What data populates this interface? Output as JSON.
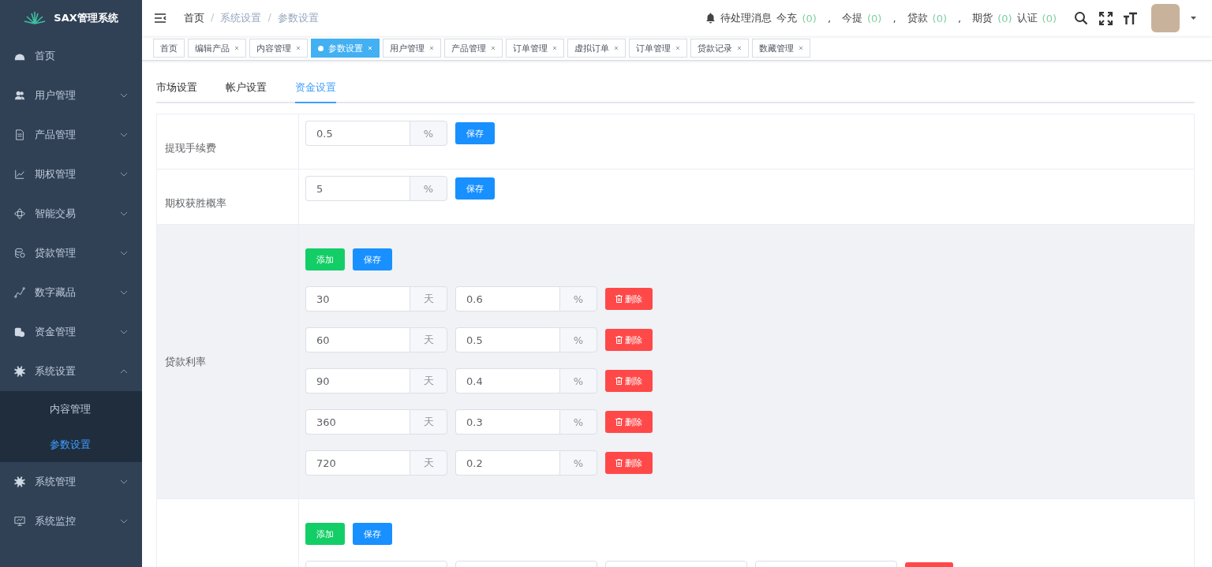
{
  "sidebar": {
    "logo": "SAX管理系统",
    "items": [
      {
        "label": "首页",
        "kind": "link"
      },
      {
        "label": "用户管理",
        "kind": "group",
        "expanded": false
      },
      {
        "label": "产品管理",
        "kind": "group",
        "expanded": false
      },
      {
        "label": "期权管理",
        "kind": "group",
        "expanded": false
      },
      {
        "label": "智能交易",
        "kind": "group",
        "expanded": false
      },
      {
        "label": "贷款管理",
        "kind": "group",
        "expanded": false
      },
      {
        "label": "数字藏品",
        "kind": "group",
        "expanded": false
      },
      {
        "label": "资金管理",
        "kind": "group",
        "expanded": false
      },
      {
        "label": "系统设置",
        "kind": "group",
        "expanded": true,
        "children": [
          {
            "label": "内容管理",
            "selected": false
          },
          {
            "label": "参数设置",
            "selected": true
          }
        ]
      },
      {
        "label": "系统管理",
        "kind": "group",
        "expanded": false
      },
      {
        "label": "系统监控",
        "kind": "group",
        "expanded": false
      }
    ]
  },
  "breadcrumb": [
    {
      "label": "首页"
    },
    {
      "separator": "/",
      "label": "系统设置"
    },
    {
      "separator": "/",
      "label": "参数设置"
    }
  ],
  "notices": {
    "title": "待处理消息",
    "items": [
      {
        "label": "今充",
        "count": "(0)",
        "separator": ","
      },
      {
        "label": "今提",
        "count": "(0)",
        "separator": ","
      },
      {
        "label": "贷款",
        "count": "(0)",
        "separator": ","
      },
      {
        "label": "期货",
        "count": "(0)"
      },
      {
        "label": "认证",
        "count": "(0)"
      }
    ]
  },
  "tags": [
    {
      "label": "首页",
      "closable": false,
      "selected": false
    },
    {
      "label": "编辑产品",
      "closable": true,
      "selected": false
    },
    {
      "label": "内容管理",
      "closable": true,
      "selected": false
    },
    {
      "label": "参数设置",
      "closable": true,
      "selected": true
    },
    {
      "label": "用户管理",
      "closable": true,
      "selected": false
    },
    {
      "label": "产品管理",
      "closable": true,
      "selected": false
    },
    {
      "label": "订单管理",
      "closable": true,
      "selected": false
    },
    {
      "label": "虚拟订单",
      "closable": true,
      "selected": false
    },
    {
      "label": "订单管理",
      "closable": true,
      "selected": false
    },
    {
      "label": "贷款记录",
      "closable": true,
      "selected": false
    },
    {
      "label": "数藏管理",
      "closable": true,
      "selected": false
    }
  ],
  "tabs": [
    {
      "label": "市场设置",
      "selected": false
    },
    {
      "label": "帐户设置",
      "selected": false
    },
    {
      "label": "资金设置",
      "selected": true
    }
  ],
  "sections": [
    {
      "kind": "single",
      "label": "提现手续费",
      "highlighted": false,
      "value": "0.5",
      "unit": "%",
      "save": "保存"
    },
    {
      "kind": "single",
      "label": "期权获胜概率",
      "highlighted": false,
      "value": "5",
      "unit": "%",
      "save": "保存"
    },
    {
      "kind": "tiers",
      "label": "贷款利率",
      "highlighted": true,
      "add": "添加",
      "save": "保存",
      "tiers": [
        {
          "days": "30",
          "day_unit": "天",
          "rate": "0.6",
          "rate_unit": "%",
          "delete": "删除"
        },
        {
          "days": "60",
          "day_unit": "天",
          "rate": "0.5",
          "rate_unit": "%",
          "delete": "删除"
        },
        {
          "days": "90",
          "day_unit": "天",
          "rate": "0.4",
          "rate_unit": "%",
          "delete": "删除"
        },
        {
          "days": "360",
          "day_unit": "天",
          "rate": "0.3",
          "rate_unit": "%",
          "delete": "删除"
        },
        {
          "days": "720",
          "day_unit": "天",
          "rate": "0.2",
          "rate_unit": "%",
          "delete": "删除"
        }
      ]
    },
    {
      "kind": "partial",
      "highlighted": false,
      "add": "添加",
      "save": "保存",
      "fields": [
        {
          "kind": "input"
        },
        {
          "kind": "input"
        },
        {
          "kind": "input"
        },
        {
          "kind": "input"
        },
        {
          "kind": "button"
        }
      ]
    }
  ]
}
